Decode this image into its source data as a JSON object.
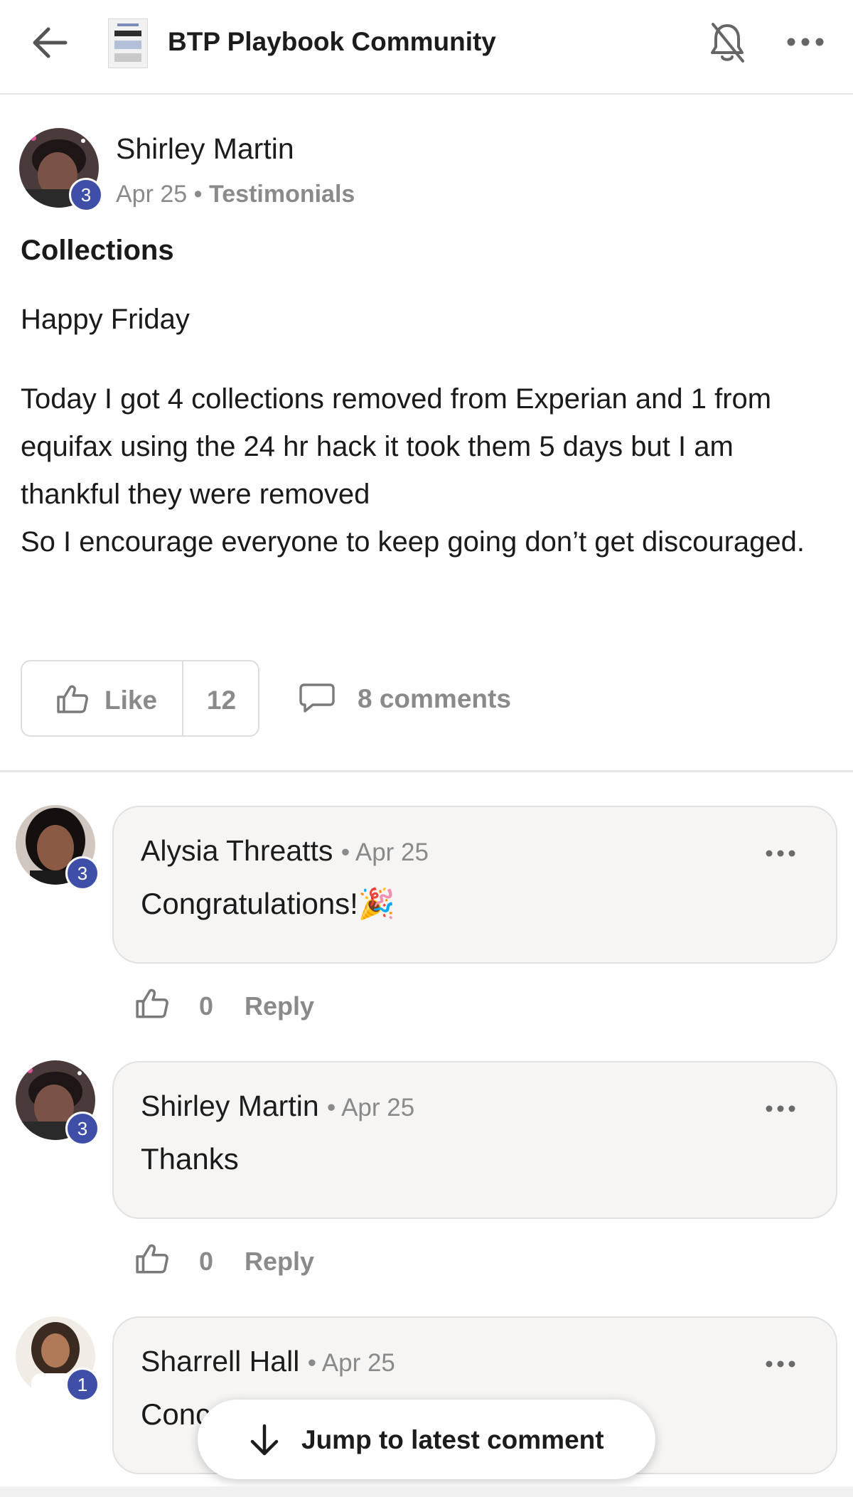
{
  "header": {
    "group_name": "BTP Playbook Community",
    "icons": [
      "back-arrow-icon",
      "group-logo",
      "bell-off-icon",
      "more-horizontal-icon"
    ]
  },
  "post": {
    "author": "Shirley Martin",
    "level": "3",
    "date": "Apr 25",
    "separator": "•",
    "category": "Testimonials",
    "title": "Collections",
    "body": [
      "Happy Friday",
      "Today I got 4 collections removed from Experian and 1 from equifax using the 24 hr hack it took them 5 days but I am thankful they were removed",
      "So I encourage everyone to keep going don’t get discouraged."
    ],
    "like_label": "Like",
    "like_count": "12",
    "comments_label": "8 comments"
  },
  "comments": [
    {
      "author": "Alysia Threatts",
      "date": "• Apr 25",
      "level": "3",
      "text": "Congratulations!🎉",
      "likes": "0",
      "reply_label": "Reply"
    },
    {
      "author": "Shirley Martin",
      "date": "• Apr 25",
      "level": "3",
      "text": "Thanks",
      "likes": "0",
      "reply_label": "Reply"
    },
    {
      "author": "Sharrell Hall",
      "date": "• Apr 25",
      "level": "1",
      "text": "Conc"
    }
  ],
  "jump_button": {
    "label": "Jump to latest comment"
  },
  "colors": {
    "badge": "#3f4fa8",
    "muted_text": "#8a8a8a",
    "bubble_bg": "#f6f5f3"
  }
}
